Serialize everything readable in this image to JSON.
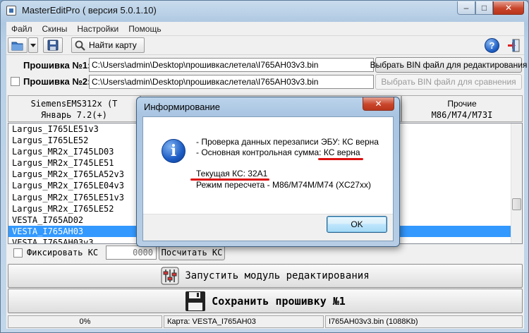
{
  "window": {
    "title": "MasterEditPro ( версия 5.0.1.10)",
    "controls": {
      "minimize": "–",
      "maximize": "□",
      "close": "✕"
    }
  },
  "menu": [
    "Файл",
    "Скины",
    "Настройки",
    "Помощь"
  ],
  "toolbar": {
    "find_label": "Найти карту",
    "icons": [
      "folder-open-icon",
      "dropdown-arrow-icon",
      "save-icon",
      "magnifier-icon",
      "help-icon",
      "exit-icon"
    ]
  },
  "firmware1": {
    "label": "Прошивка №1:",
    "path": "C:\\Users\\admin\\Desktop\\прошивкаслетела\\I765AH03v3.bin",
    "button": "Выбрать BIN файл для редактирования"
  },
  "firmware2": {
    "label": "Прошивка №2:",
    "path": "C:\\Users\\admin\\Desktop\\прошивкаслетела\\I765AH03v3.bin",
    "button": "Выбрать BIN файл для сравнения"
  },
  "tabs": [
    {
      "line1": "SiemensEMS312x (T",
      "line2": "Январь 7.2(+)"
    },
    {
      "line1": "",
      "line2": ""
    },
    {
      "line1": "Прочие",
      "line2": "M86/M74/M73I"
    }
  ],
  "list": {
    "items": [
      "Largus_I765LE51v3",
      "Largus_I765LE52",
      "Largus_MR2x_I745LD03",
      "Largus_MR2x_I745LE51",
      "Largus_MR2x_I765LA52v3",
      "Largus_MR2x_I765LE04v3",
      "Largus_MR2x_I765LE51v3",
      "Largus_MR2x_I765LE52",
      "VESTA_I765AD02",
      "VESTA_I765AH03",
      "VESTA_I765AH03v3"
    ],
    "selected_index": 9
  },
  "checksum": {
    "fix_label": "Фиксировать КС",
    "value_placeholder": "0000",
    "calc_button": "Посчитать КС"
  },
  "actions": {
    "run_editor": "Запустить модуль редактирования",
    "save_firmware": "Сохранить прошивку №1"
  },
  "status": {
    "progress": "0%",
    "map": "Карта: VESTA_I765AH03",
    "file": "I765AH03v3.bin (1088Kb)"
  },
  "dialog": {
    "title": "Информирование",
    "line1": "- Проверка данных перезаписи ЭБУ: КС верна",
    "line2_prefix": "- Основная контрольная сумма:",
    "line2_value": " КС верна",
    "line3": "Текущая КС: 32A1",
    "line4": "Режим пересчета - M86/M74M/M74 (XC27xx)",
    "ok": "OK",
    "icon": "info-icon",
    "highlight_color": "#dd1111"
  }
}
